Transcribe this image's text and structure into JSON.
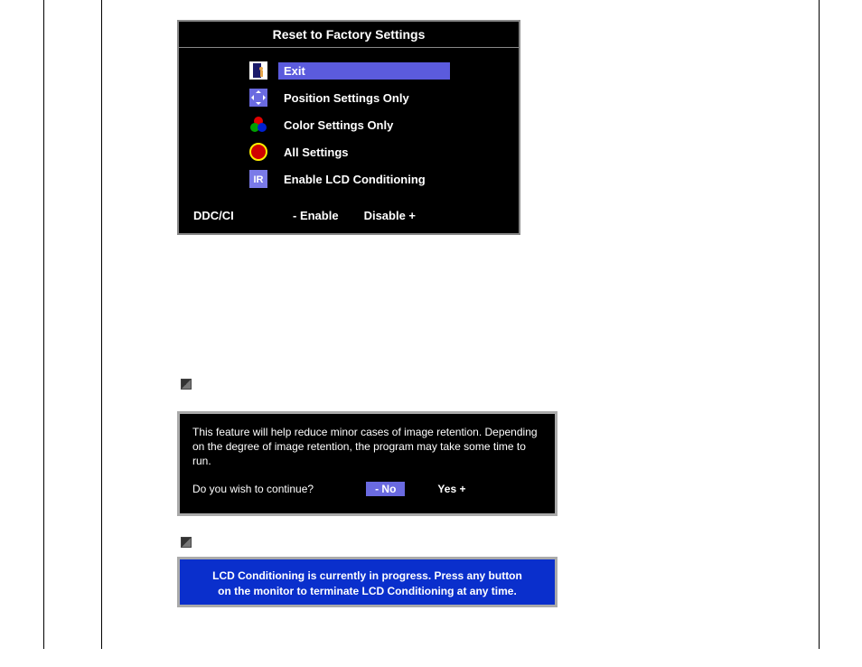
{
  "osd": {
    "title": "Reset to Factory Settings",
    "items": [
      {
        "label": "Exit",
        "selected": true
      },
      {
        "label": "Position Settings Only",
        "selected": false
      },
      {
        "label": "Color Settings Only",
        "selected": false
      },
      {
        "label": "All Settings",
        "selected": false
      },
      {
        "label": "Enable LCD Conditioning",
        "selected": false
      }
    ],
    "footer": {
      "label": "DDC/CI",
      "enable": "- Enable",
      "disable": "Disable +"
    }
  },
  "dialog": {
    "text": "This feature will help reduce minor cases of image retention. Depending on the degree of image retention, the program may take some time to run.",
    "question": "Do you wish to continue?",
    "no": "- No",
    "yes": "Yes +"
  },
  "progress": {
    "text": "LCD Conditioning is currently in progress. Press any button on the monitor to terminate LCD Conditioning at any time."
  }
}
